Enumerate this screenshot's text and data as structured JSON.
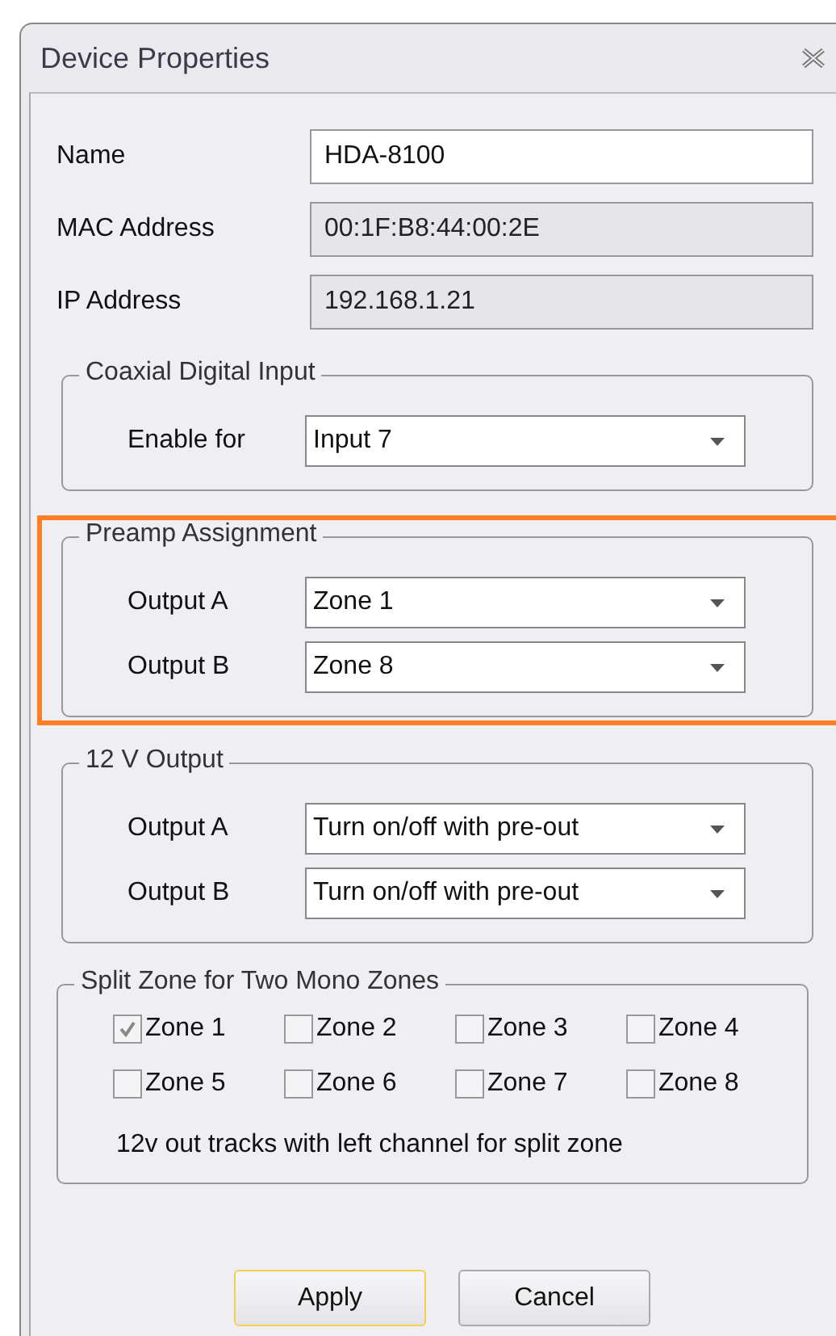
{
  "window": {
    "title": "Device Properties"
  },
  "fields": [
    {
      "label": "Name",
      "value": "HDA-8100",
      "disabled": false
    },
    {
      "label": "MAC Address",
      "value": "00:1F:B8:44:00:2E",
      "disabled": true
    },
    {
      "label": "IP Address",
      "value": "192.168.1.21",
      "disabled": true
    }
  ],
  "groups": [
    {
      "title": "Coaxial Digital Input",
      "rows": [
        {
          "label": "Enable for",
          "value": "Input 7"
        }
      ]
    },
    {
      "title": "Preamp Assignment",
      "highlighted": true,
      "rows": [
        {
          "label": "Output A",
          "value": "Zone 1"
        },
        {
          "label": "Output B",
          "value": "Zone 8"
        }
      ]
    },
    {
      "title": "12 V Output",
      "rows": [
        {
          "label": "Output A",
          "value": "Turn on/off with pre-out"
        },
        {
          "label": "Output B",
          "value": "Turn on/off with pre-out"
        }
      ]
    }
  ],
  "split_zone": {
    "title": "Split Zone for Two Mono Zones",
    "zones": [
      {
        "label": "Zone 1",
        "checked": true
      },
      {
        "label": "Zone 2",
        "checked": false
      },
      {
        "label": "Zone 3",
        "checked": false
      },
      {
        "label": "Zone 4",
        "checked": false
      },
      {
        "label": "Zone 5",
        "checked": false
      },
      {
        "label": "Zone 6",
        "checked": false
      },
      {
        "label": "Zone 7",
        "checked": false
      },
      {
        "label": "Zone 8",
        "checked": false
      }
    ],
    "note": "12v out tracks with left channel for split zone"
  },
  "buttons": [
    {
      "label": "Apply",
      "default": true
    },
    {
      "label": "Cancel",
      "default": false
    }
  ]
}
